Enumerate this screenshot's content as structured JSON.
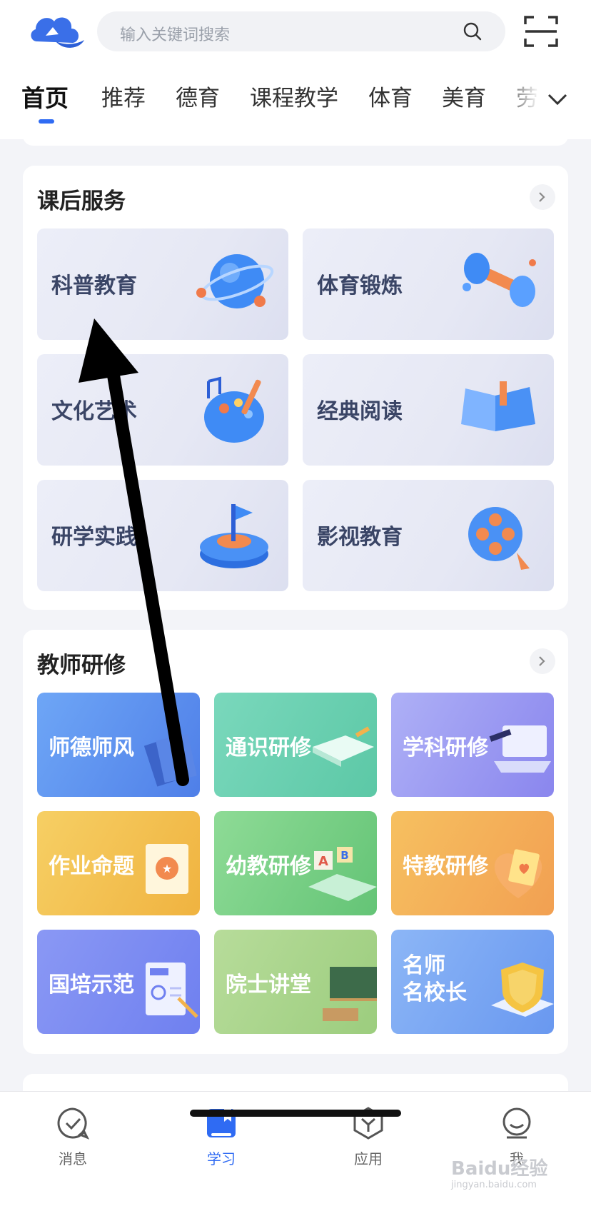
{
  "search": {
    "placeholder": "输入关键词搜索"
  },
  "tabs": [
    {
      "label": "首页"
    },
    {
      "label": "推荐"
    },
    {
      "label": "德育"
    },
    {
      "label": "课程教学"
    },
    {
      "label": "体育"
    },
    {
      "label": "美育"
    },
    {
      "label": "劳"
    }
  ],
  "after_school": {
    "title": "课后服务",
    "items": [
      {
        "label": "科普教育",
        "icon": "science-globe-icon"
      },
      {
        "label": "体育锻炼",
        "icon": "dumbbell-icon"
      },
      {
        "label": "文化艺术",
        "icon": "art-palette-icon"
      },
      {
        "label": "经典阅读",
        "icon": "open-book-icon"
      },
      {
        "label": "研学实践",
        "icon": "flag-platform-icon"
      },
      {
        "label": "影视教育",
        "icon": "film-reel-icon"
      }
    ]
  },
  "teacher_training": {
    "title": "教师研修",
    "items": [
      {
        "label": "师德师风",
        "color": "#5b8ef0"
      },
      {
        "label": "通识研修",
        "color": "#6fd0b0"
      },
      {
        "label": "学科研修",
        "color": "#9b8cf3"
      },
      {
        "label": "作业命题",
        "color": "#f2c04c"
      },
      {
        "label": "幼教研修",
        "color": "#7fd38a"
      },
      {
        "label": "特教研修",
        "color": "#f3aa58"
      },
      {
        "label": "国培示范",
        "color": "#7a89f2"
      },
      {
        "label": "院士讲堂",
        "color": "#a9d58c"
      },
      {
        "label": "名师名校长",
        "line1": "名师",
        "line2": "名校长",
        "color": "#7ba6f5"
      }
    ]
  },
  "bottom_nav": [
    {
      "label": "消息",
      "icon": "message-check-icon"
    },
    {
      "label": "学习",
      "icon": "study-book-icon",
      "active": true
    },
    {
      "label": "应用",
      "icon": "apps-cube-icon"
    },
    {
      "label": "我",
      "icon": "profile-icon"
    }
  ],
  "watermark": {
    "brand": "Baidu经验",
    "url": "jingyan.baidu.com"
  },
  "colors": {
    "accent": "#2f6bf3",
    "page_bg": "#f3f4f8"
  }
}
